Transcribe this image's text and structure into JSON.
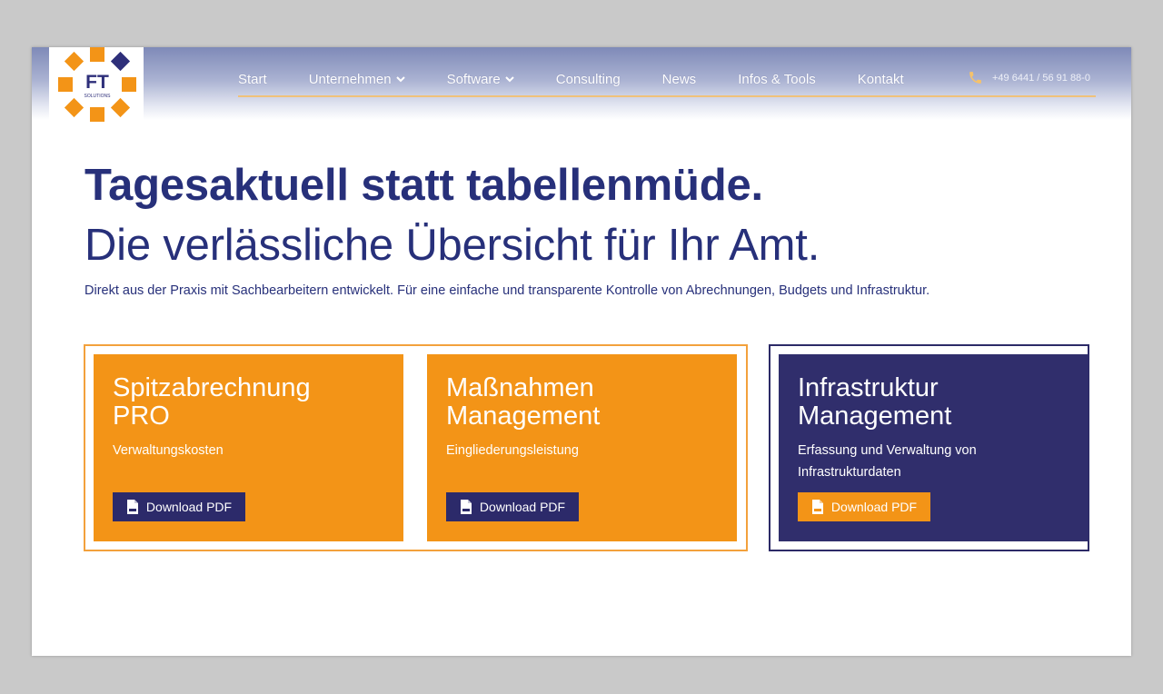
{
  "logo": {
    "text": "FT",
    "subtext": "SOLUTIONS"
  },
  "nav": {
    "items": [
      {
        "label": "Start",
        "dropdown": false
      },
      {
        "label": "Unternehmen",
        "dropdown": true
      },
      {
        "label": "Software",
        "dropdown": true
      },
      {
        "label": "Consulting",
        "dropdown": false
      },
      {
        "label": "News",
        "dropdown": false
      },
      {
        "label": "Infos & Tools",
        "dropdown": false
      },
      {
        "label": "Kontakt",
        "dropdown": false
      }
    ],
    "phone": "+49 6441 / 56 91 88-0"
  },
  "hero": {
    "headline_bold": "Tagesaktuell statt tabellenmüde.",
    "headline_regular": "Die verlässliche Übersicht für Ihr Amt.",
    "intro": "Direkt aus der Praxis mit Sachbearbeitern entwickelt. Für eine einfache und transparente Kontrolle von Abrechnungen, Budgets und Infrastruktur."
  },
  "cards": [
    {
      "title_line1": "Spitzabrechnung",
      "title_line2": "PRO",
      "subtitle": "Verwaltungskosten",
      "button": "Download PDF"
    },
    {
      "title_line1": "Maßnahmen",
      "title_line2": "Management",
      "subtitle": "Eingliederungsleistung",
      "button": "Download PDF"
    },
    {
      "title_line1": "Infrastruktur",
      "title_line2": "Management",
      "subtitle": "Erfassung und Verwaltung von Infrastrukturdaten",
      "button": "Download PDF"
    }
  ],
  "colors": {
    "navy": "#27307a",
    "orange": "#f39417",
    "card_navy": "#302e6c",
    "nav_line": "#f0c27a"
  },
  "icons": {
    "nav_dropdown": "chevron-down-icon",
    "phone": "phone-icon",
    "button": "pdf-file-icon"
  }
}
